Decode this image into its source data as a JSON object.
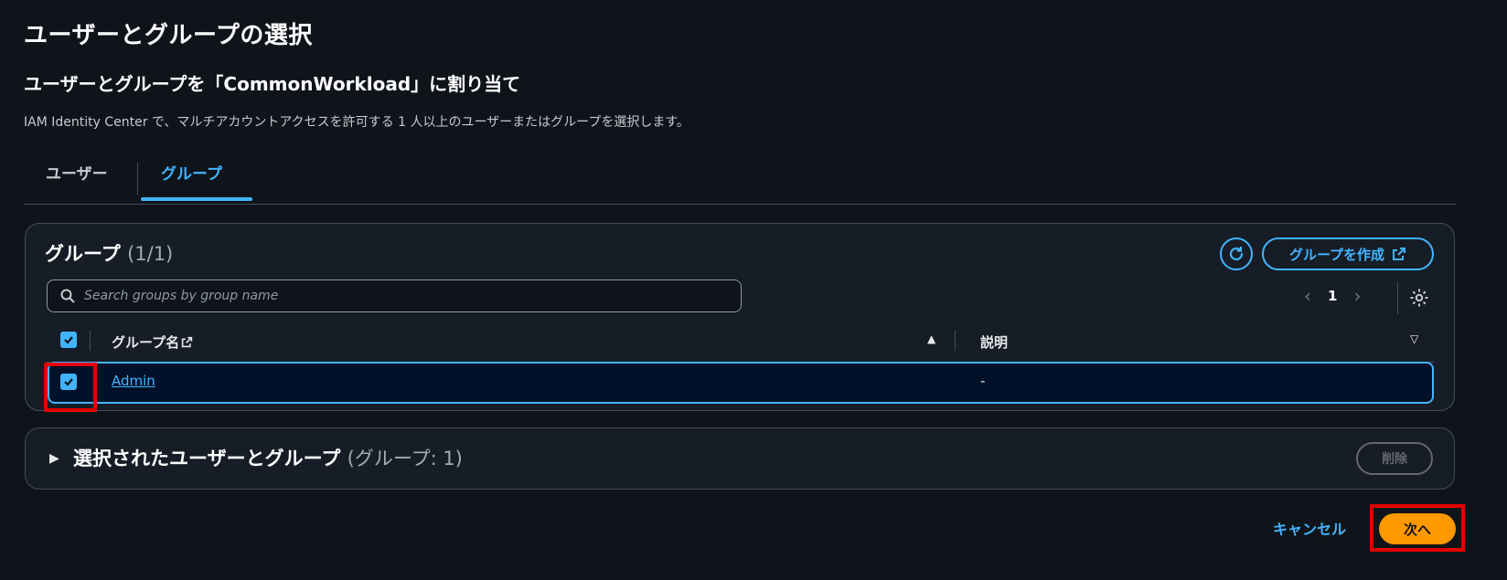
{
  "page": {
    "title": "ユーザーとグループの選択",
    "section_title": "ユーザーとグループを「CommonWorkload」に割り当て",
    "description": "IAM Identity Center で、マルチアカウントアクセスを許可する 1 人以上のユーザーまたはグループを選択します。"
  },
  "tabs": [
    {
      "label": "ユーザー",
      "active": false
    },
    {
      "label": "グループ",
      "active": true
    }
  ],
  "groups_panel": {
    "title": "グループ",
    "count": "(1/1)",
    "create_button": "グループを作成",
    "search_placeholder": "Search groups by group name",
    "pagination": {
      "current_page": "1"
    },
    "columns": {
      "name": "グループ名",
      "description": "説明"
    },
    "rows": [
      {
        "name": "Admin",
        "description": "-",
        "selected": true
      }
    ]
  },
  "selected_panel": {
    "title": "選択されたユーザーとグループ",
    "count": "(グループ: 1)",
    "remove_button": "削除"
  },
  "footer": {
    "cancel": "キャンセル",
    "next": "次へ"
  },
  "colors": {
    "background": "#0f141a",
    "accent": "#42b4ff",
    "primary_button": "#ff9900",
    "highlight_box": "#e50000"
  }
}
